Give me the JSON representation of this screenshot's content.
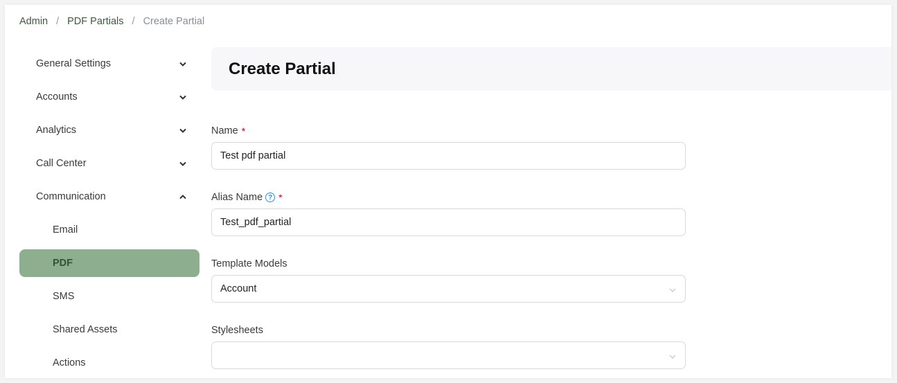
{
  "breadcrumb": [
    {
      "label": "Admin"
    },
    {
      "label": "PDF Partials"
    },
    {
      "label": "Create Partial"
    }
  ],
  "breadcrumb_separator": "/",
  "sidebar": {
    "sections": [
      {
        "label": "General Settings",
        "expanded": false
      },
      {
        "label": "Accounts",
        "expanded": false
      },
      {
        "label": "Analytics",
        "expanded": false
      },
      {
        "label": "Call Center",
        "expanded": false
      },
      {
        "label": "Communication",
        "expanded": true
      }
    ],
    "sub_items": [
      {
        "label": "Email",
        "active": false
      },
      {
        "label": "PDF",
        "active": true
      },
      {
        "label": "SMS",
        "active": false
      },
      {
        "label": "Shared Assets",
        "active": false
      },
      {
        "label": "Actions",
        "active": false
      }
    ]
  },
  "page": {
    "title": "Create Partial"
  },
  "form": {
    "name": {
      "label": "Name",
      "required_mark": "*",
      "value": "Test pdf partial"
    },
    "alias_name": {
      "label": "Alias Name",
      "help_icon": "?",
      "required_mark": "*",
      "value": "Test_pdf_partial"
    },
    "template_models": {
      "label": "Template Models",
      "value": "Account"
    },
    "stylesheets": {
      "label": "Stylesheets",
      "value": ""
    }
  },
  "colors": {
    "accent_active_bg": "#8dae8f",
    "accent_active_text": "#2f5632",
    "required": "#d0021b",
    "help": "#2a8fe0"
  }
}
